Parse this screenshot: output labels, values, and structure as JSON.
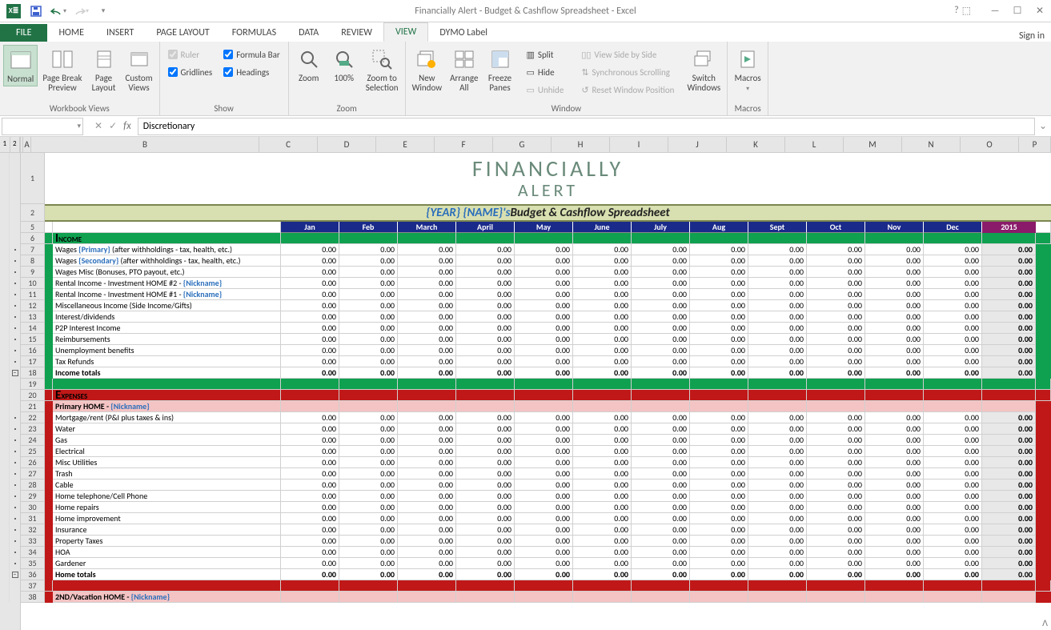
{
  "title": "Financially Alert - Budget & Cashflow Spreadsheet - Excel",
  "sign_in": "Sign in",
  "tabs": {
    "file": "FILE",
    "home": "HOME",
    "insert": "INSERT",
    "page_layout": "PAGE LAYOUT",
    "formulas": "FORMULAS",
    "data": "DATA",
    "review": "REVIEW",
    "view": "VIEW",
    "dymo": "DYMO Label"
  },
  "ribbon": {
    "workbook_views": {
      "label": "Workbook Views",
      "normal": "Normal",
      "page_break": "Page Break\nPreview",
      "page_layout": "Page\nLayout",
      "custom": "Custom\nViews"
    },
    "show": {
      "label": "Show",
      "ruler": "Ruler",
      "gridlines": "Gridlines",
      "formula_bar": "Formula Bar",
      "headings": "Headings"
    },
    "zoom": {
      "label": "Zoom",
      "zoom": "Zoom",
      "hundred": "100%",
      "selection": "Zoom to\nSelection"
    },
    "window": {
      "label": "Window",
      "new_window": "New\nWindow",
      "arrange_all": "Arrange\nAll",
      "freeze": "Freeze\nPanes",
      "split": "Split",
      "hide": "Hide",
      "unhide": "Unhide",
      "side_by_side": "View Side by Side",
      "sync_scroll": "Synchronous Scrolling",
      "reset_pos": "Reset Window Position",
      "switch": "Switch\nWindows"
    },
    "macros": {
      "label": "Macros",
      "macros": "Macros"
    }
  },
  "formula_bar": {
    "cell_ref": "",
    "value": "Discretionary"
  },
  "columns": [
    "A",
    "B",
    "C",
    "D",
    "E",
    "F",
    "G",
    "H",
    "I",
    "J",
    "K",
    "L",
    "M",
    "N",
    "O",
    "P"
  ],
  "row_numbers": [
    1,
    2,
    5,
    6,
    7,
    8,
    9,
    10,
    11,
    12,
    13,
    14,
    15,
    16,
    17,
    18,
    19,
    20,
    21,
    22,
    23,
    24,
    25,
    26,
    27,
    28,
    29,
    30,
    31,
    32,
    33,
    34,
    35,
    36,
    37,
    38
  ],
  "banner": {
    "line1": "FINANCIALLY",
    "line2": "ALERT"
  },
  "heading": {
    "year": "{YEAR}",
    "name": "{NAME}'s",
    "rest": " Budget & Cashflow Spreadsheet"
  },
  "months": [
    "Jan",
    "Feb",
    "March",
    "April",
    "May",
    "June",
    "July",
    "Aug",
    "Sept",
    "Oct",
    "Nov",
    "Dec"
  ],
  "year_col": "2015",
  "outline": {
    "h1": "1",
    "h2": "2"
  },
  "income": {
    "title": "Income",
    "rows": [
      {
        "label": "Wages ",
        "ph": "{Primary}",
        "suffix": " (after withholdings - tax, health, etc.)"
      },
      {
        "label": "Wages ",
        "ph": "{Secondary}",
        "suffix": " (after withholdings - tax, health, etc.)"
      },
      {
        "label": "Wages Misc (Bonuses, PTO payout, etc.)"
      },
      {
        "label": "Rental Income - Investment HOME #2 - ",
        "ph": "{Nickname}"
      },
      {
        "label": "Rental Income - Investment HOME #1 - ",
        "ph": "{Nickname}"
      },
      {
        "label": "Miscellaneous Income (Side Income/Gifts)"
      },
      {
        "label": "Interest/dividends"
      },
      {
        "label": "P2P Interest Income"
      },
      {
        "label": "Reimbursements"
      },
      {
        "label": "Unemployment benefits"
      },
      {
        "label": "Tax Refunds"
      }
    ],
    "total_label": "Income totals"
  },
  "expenses": {
    "title": "Expenses",
    "primary_home": {
      "label": "Primary HOME - ",
      "nick": "{Nickname}"
    },
    "rows": [
      {
        "label": "Mortgage/rent (P&I plus taxes & ins)"
      },
      {
        "label": "Water"
      },
      {
        "label": "Gas"
      },
      {
        "label": "Electrical"
      },
      {
        "label": "Misc Utilities"
      },
      {
        "label": "Trash"
      },
      {
        "label": "Cable"
      },
      {
        "label": "Home telephone/Cell Phone"
      },
      {
        "label": "Home repairs"
      },
      {
        "label": "Home improvement"
      },
      {
        "label": "Insurance"
      },
      {
        "label": "Property Taxes"
      },
      {
        "label": "HOA"
      },
      {
        "label": "Gardener"
      }
    ],
    "total_label": "Home totals",
    "vacation": {
      "label": "2ND/Vacation HOME - ",
      "nick": "{Nickname}"
    }
  },
  "zero": "0.00"
}
